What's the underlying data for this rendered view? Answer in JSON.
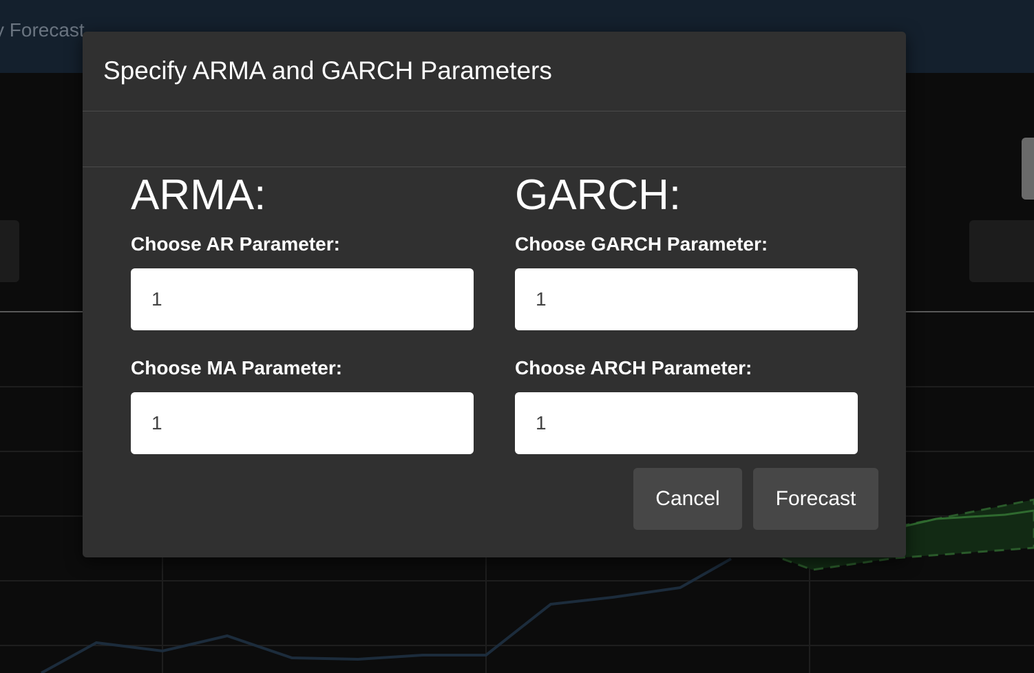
{
  "background": {
    "nav_title": "y Forecast"
  },
  "modal": {
    "title": "Specify ARMA and GARCH Parameters",
    "arma": {
      "heading": "ARMA:",
      "ar_label": "Choose AR Parameter:",
      "ar_value": "1",
      "ma_label": "Choose MA Parameter:",
      "ma_value": "1"
    },
    "garch": {
      "heading": "GARCH:",
      "garch_label": "Choose GARCH Parameter:",
      "garch_value": "1",
      "arch_label": "Choose ARCH Parameter:",
      "arch_value": "1"
    },
    "buttons": {
      "cancel": "Cancel",
      "forecast": "Forecast"
    }
  },
  "colors": {
    "modal_bg": "#303030",
    "button_bg": "#474747",
    "navbar_bg": "#14202d"
  }
}
